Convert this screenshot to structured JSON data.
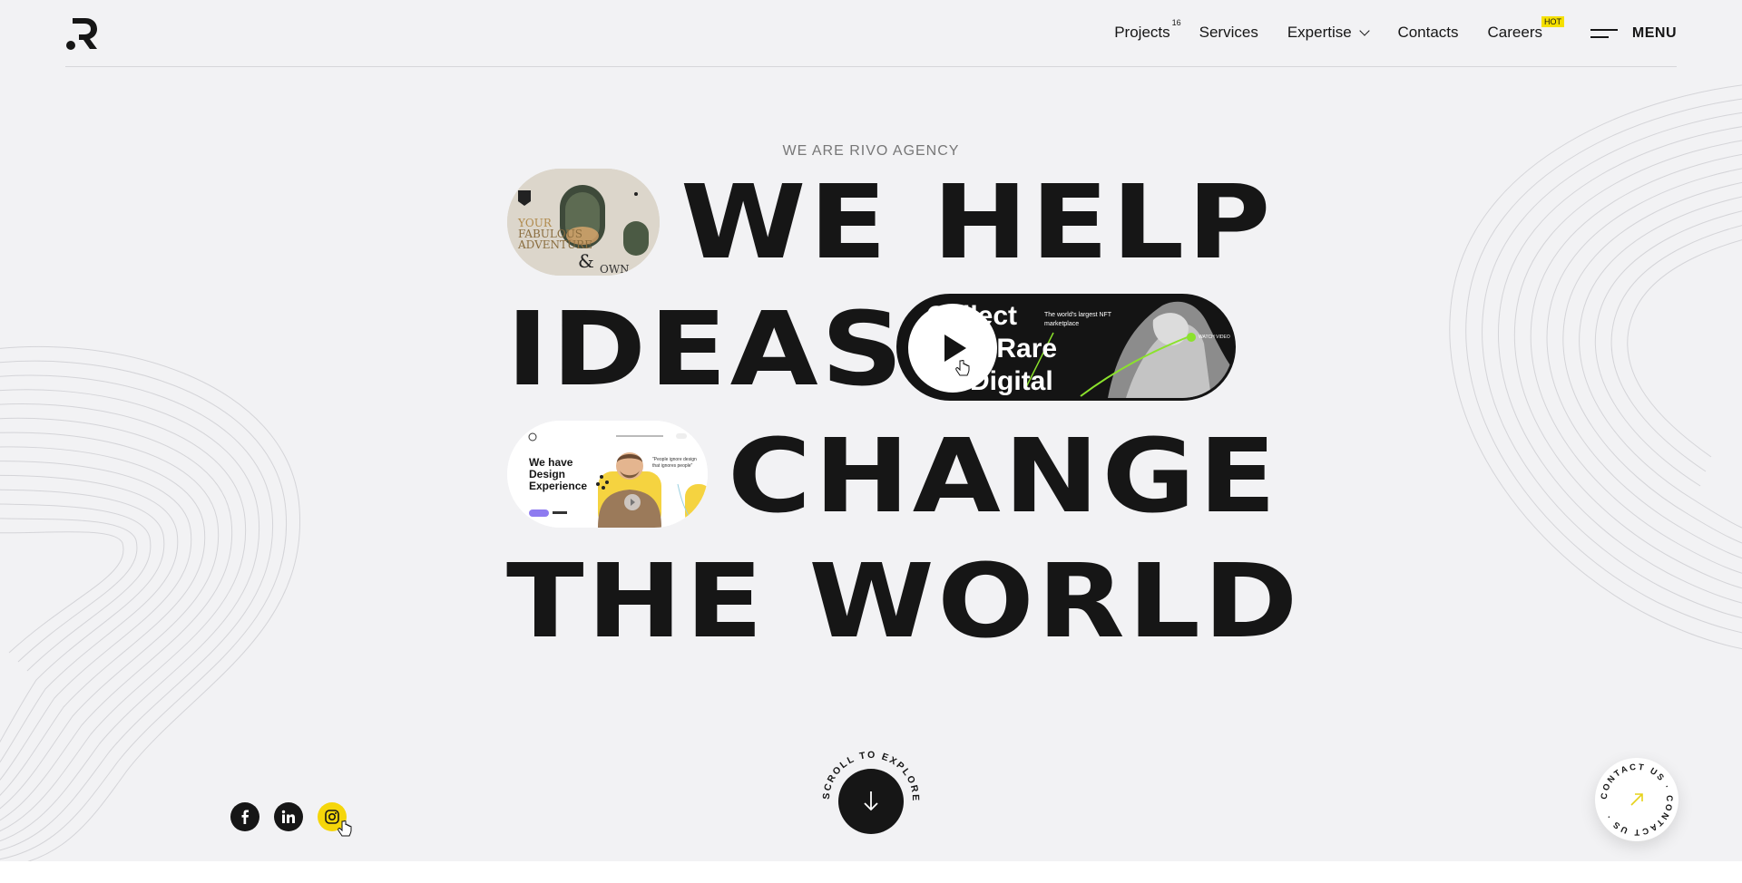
{
  "header": {
    "logo_text": "R",
    "nav": [
      {
        "label": "Projects",
        "sup": "16"
      },
      {
        "label": "Services"
      },
      {
        "label": "Expertise"
      },
      {
        "label": "Contacts"
      },
      {
        "label": "Careers",
        "badge": "HOT"
      }
    ],
    "menu_label": "MENU"
  },
  "hero": {
    "eyebrow": "WE ARE RIVO AGENCY",
    "line1": "WE HELP",
    "line2": "IDEAS",
    "line3": "CHANGE",
    "line4": "THE WORLD"
  },
  "pill1": {
    "text1": "YOUR",
    "text2": "FABULOUS",
    "text3": "ADVENTURE",
    "amp": "&",
    "own": "OWN"
  },
  "pill2": {
    "title1": "Collect",
    "title2": "Super Rare",
    "title3": "Digital",
    "sub1": "The world's largest NFT",
    "sub2": "marketplace",
    "watch": "WATCH VIDEO"
  },
  "pill3": {
    "line1": "We have",
    "line2": "Design",
    "line3": "Experience",
    "quote1": "\"People ignore design",
    "quote2": "that ignores people\""
  },
  "scroll": {
    "label": "SCROLL TO EXPLORE"
  },
  "contact": {
    "label": "CONTACT US · CONTACT US ·"
  },
  "colors": {
    "background": "#f2f2f4",
    "ink": "#161616",
    "accent": "#f5d60a",
    "green": "#8be22c"
  }
}
